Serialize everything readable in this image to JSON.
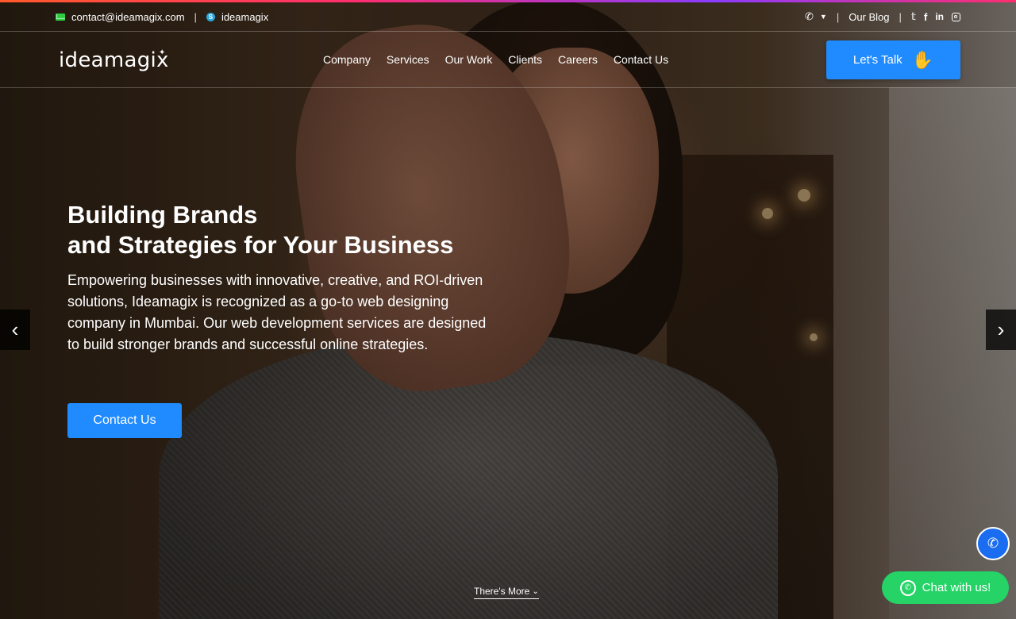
{
  "topbar": {
    "email": "contact@ideamagix.com",
    "separator": "|",
    "skype": "ideamagix",
    "blog_label": "Our Blog",
    "social_separator": "|"
  },
  "nav": {
    "logo": "ideamagix",
    "links": [
      "Company",
      "Services",
      "Our Work",
      "Clients",
      "Careers",
      "Contact Us"
    ],
    "talk_button": "Let's Talk"
  },
  "hero": {
    "title_line1": "Building Brands",
    "title_line2": "and Strategies for Your Business",
    "description": "Empowering businesses with innovative, creative, and ROI-driven solutions, Ideamagix is recognized as a go-to web designing company in Mumbai. Our web development services are designed to build stronger brands and successful online strategies.",
    "cta": "Contact Us",
    "prev": "‹",
    "next": "›",
    "more": "There's More"
  },
  "floating": {
    "chat": "Chat with us!"
  },
  "colors": {
    "accent_blue": "#1f8bff",
    "whatsapp_green": "#25d366",
    "call_blue": "#1a6cf0"
  }
}
